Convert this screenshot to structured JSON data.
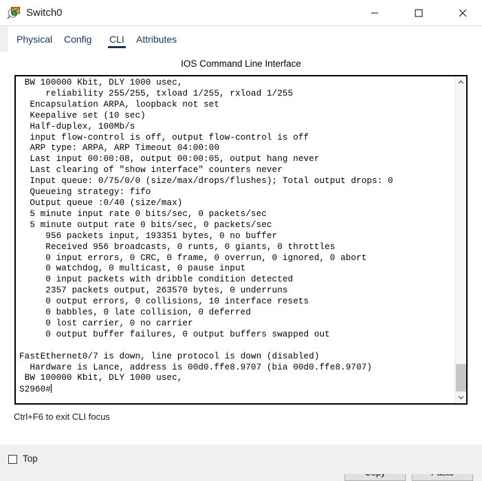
{
  "window": {
    "title": "Switch0",
    "icon": "inspect-magnifier-icon",
    "minimize_label": "Minimize",
    "maximize_label": "Maximize",
    "close_label": "Close"
  },
  "tabs": [
    {
      "label": "Physical",
      "active": false
    },
    {
      "label": "Config",
      "active": false
    },
    {
      "label": "CLI",
      "active": true
    },
    {
      "label": "Attributes",
      "active": false
    }
  ],
  "cli": {
    "header": "IOS Command Line Interface",
    "prompt": "S2960#",
    "output": " BW 100000 Kbit, DLY 1000 usec,\n     reliability 255/255, txload 1/255, rxload 1/255\n  Encapsulation ARPA, loopback not set\n  Keepalive set (10 sec)\n  Half-duplex, 100Mb/s\n  input flow-control is off, output flow-control is off\n  ARP type: ARPA, ARP Timeout 04:00:00\n  Last input 00:00:08, output 00:00:05, output hang never\n  Last clearing of \"show interface\" counters never\n  Input queue: 0/75/0/0 (size/max/drops/flushes); Total output drops: 0\n  Queueing strategy: fifo\n  Output queue :0/40 (size/max)\n  5 minute input rate 0 bits/sec, 0 packets/sec\n  5 minute output rate 0 bits/sec, 0 packets/sec\n     956 packets input, 193351 bytes, 0 no buffer\n     Received 956 broadcasts, 0 runts, 0 giants, 0 throttles\n     0 input errors, 0 CRC, 0 frame, 0 overrun, 0 ignored, 0 abort\n     0 watchdog, 0 multicast, 0 pause input\n     0 input packets with dribble condition detected\n     2357 packets output, 263570 bytes, 0 underruns\n     0 output errors, 0 collisions, 10 interface resets\n     0 babbles, 0 late collision, 0 deferred\n     0 lost carrier, 0 no carrier\n     0 output buffer failures, 0 output buffers swapped out\n\nFastEthernet0/7 is down, line protocol is down (disabled)\n  Hardware is Lance, address is 00d0.ffe8.9707 (bia 00d0.ffe8.9707)\n BW 100000 Kbit, DLY 1000 usec,\n"
  },
  "scrollbar": {
    "up_icon": "chevron-up-icon",
    "down_icon": "chevron-down-icon",
    "thumb_position_percent": 91
  },
  "footer": {
    "focus_hint": "Ctrl+F6 to exit CLI focus",
    "copy_label": "Copy",
    "paste_label": "Paste"
  },
  "bottom": {
    "top_checkbox_label": "Top",
    "top_checkbox_checked": false
  },
  "colors": {
    "tab_accent": "#16325c",
    "window_bg": "#ffffff",
    "chrome_bg": "#f0f0f0",
    "button_face": "#e1e1e1",
    "scrollbar_thumb": "#c7c7c7"
  }
}
